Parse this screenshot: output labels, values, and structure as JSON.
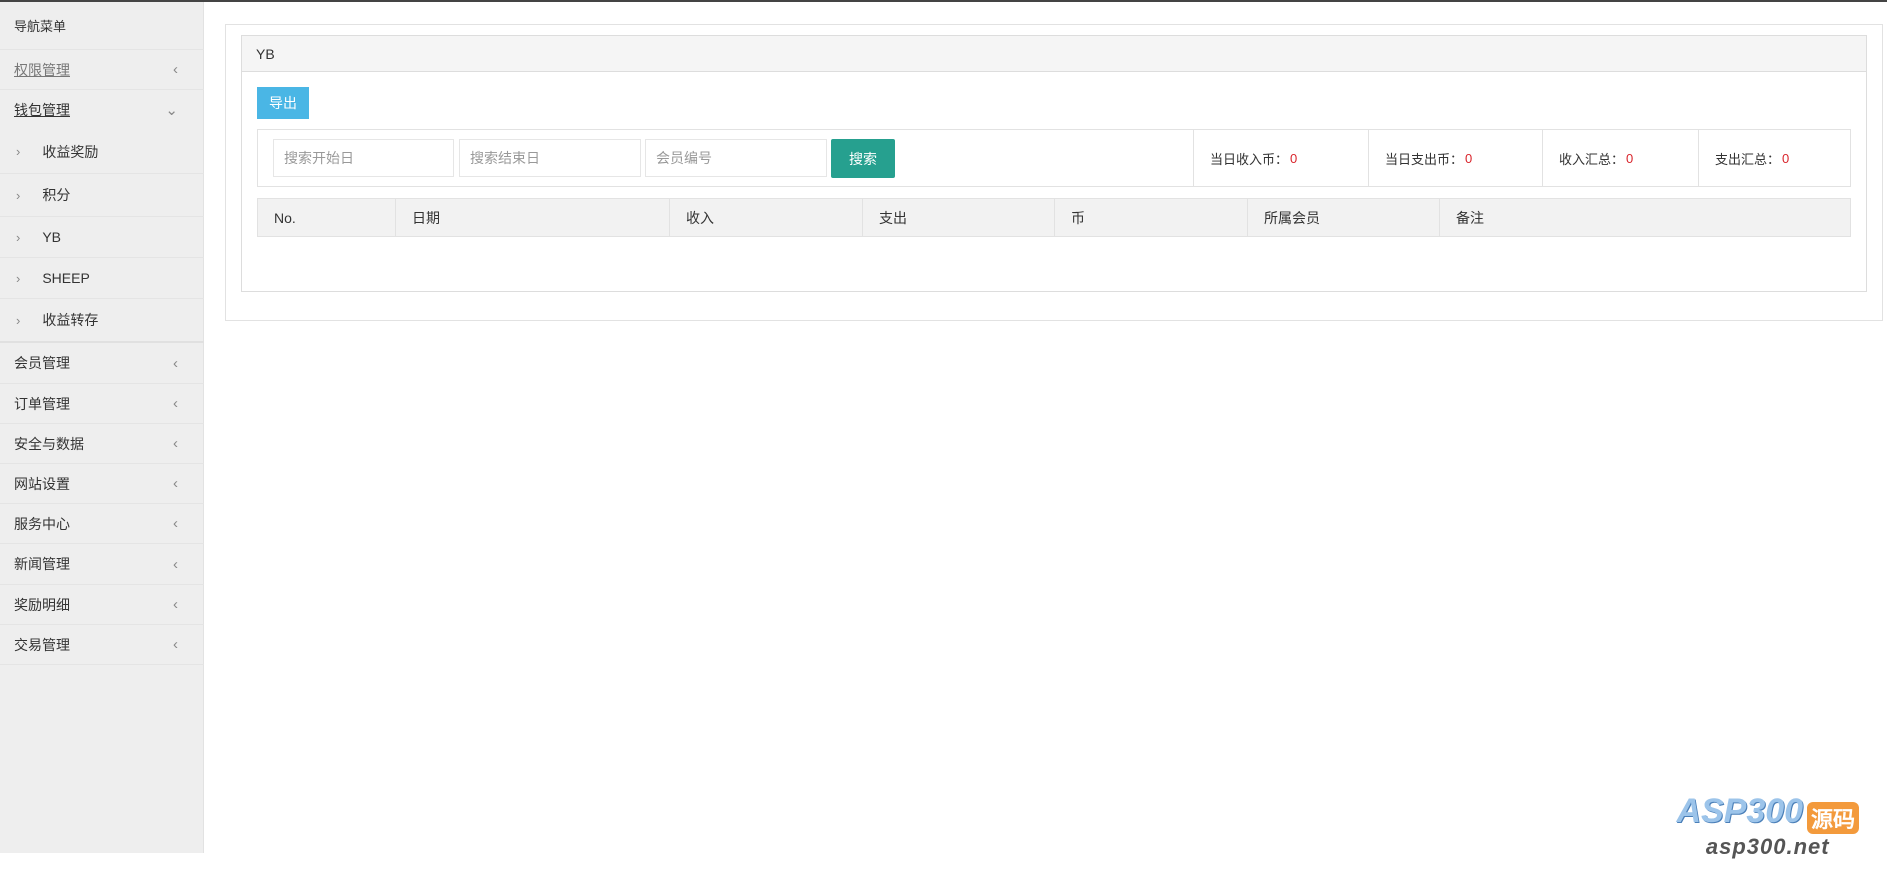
{
  "sidebar": {
    "title": "导航菜单",
    "items": [
      {
        "label": "权限管理"
      },
      {
        "label": "钱包管理",
        "sub": [
          "收益奖励",
          "积分",
          "YB",
          "SHEEP",
          "收益转存"
        ]
      },
      {
        "label": "会员管理"
      },
      {
        "label": "订单管理"
      },
      {
        "label": "安全与数据"
      },
      {
        "label": "网站设置"
      },
      {
        "label": "服务中心"
      },
      {
        "label": "新闻管理"
      },
      {
        "label": "奖励明细"
      },
      {
        "label": "交易管理"
      }
    ]
  },
  "panel": {
    "title": "YB",
    "export_label": "导出"
  },
  "search": {
    "start_placeholder": "搜索开始日",
    "end_placeholder": "搜索结束日",
    "member_placeholder": "会员编号",
    "button": "搜索"
  },
  "stats": [
    {
      "label": "当日收入币：",
      "value": "0"
    },
    {
      "label": "当日支出币：",
      "value": "0"
    },
    {
      "label": "收入汇总：",
      "value": "0"
    },
    {
      "label": "支出汇总：",
      "value": "0"
    }
  ],
  "table": {
    "columns": [
      "No.",
      "日期",
      "收入",
      "支出",
      "币",
      "所属会员",
      "备注"
    ]
  },
  "watermark": {
    "logo": "ASP300",
    "tag": "源码",
    "url": "asp300.net"
  },
  "colors": {
    "export": "#4ab6e5",
    "search": "#26a08f",
    "value": "#d9242b"
  }
}
